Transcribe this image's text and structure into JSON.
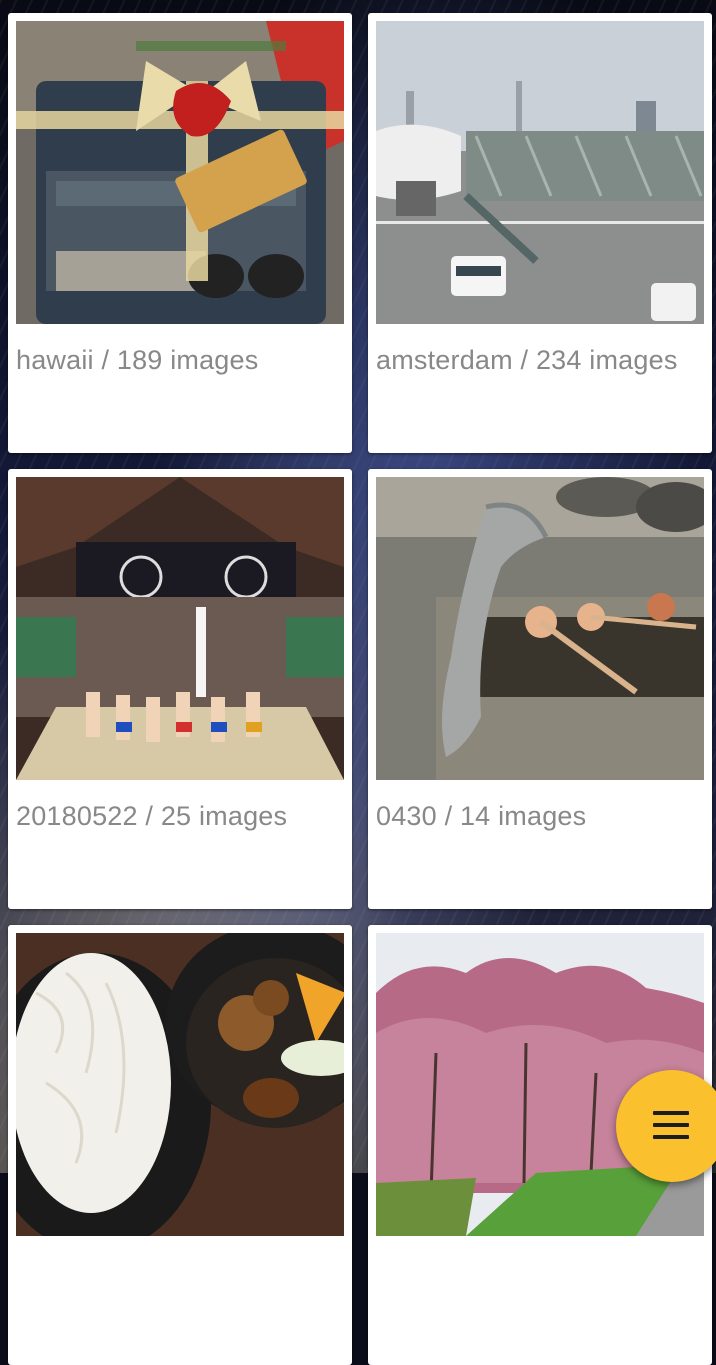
{
  "albums": [
    {
      "name": "hawaii",
      "count_text": "189 images",
      "caption": "hawaii / 189 images",
      "thumbnail": "gift-package-photo"
    },
    {
      "name": "amsterdam",
      "count_text": "234 images",
      "caption": "amsterdam / 234 images",
      "thumbnail": "airport-jetbridge-photo"
    },
    {
      "name": "20180522",
      "count_text": "25 images",
      "caption": "20180522 / 25 images",
      "thumbnail": "sumo-arena-photo"
    },
    {
      "name": "0430",
      "count_text": "14 images",
      "caption": "0430 / 14 images",
      "thumbnail": "dragon-fountain-photo"
    },
    {
      "name": "",
      "count_text": "",
      "caption": "",
      "thumbnail": "noodle-meal-photo"
    },
    {
      "name": "",
      "count_text": "",
      "caption": "",
      "thumbnail": "cherry-blossom-photo"
    }
  ],
  "fab": {
    "icon": "menu-icon",
    "color": "#fbc02d"
  },
  "colors": {
    "card": "#ffffff",
    "caption": "#888888"
  }
}
